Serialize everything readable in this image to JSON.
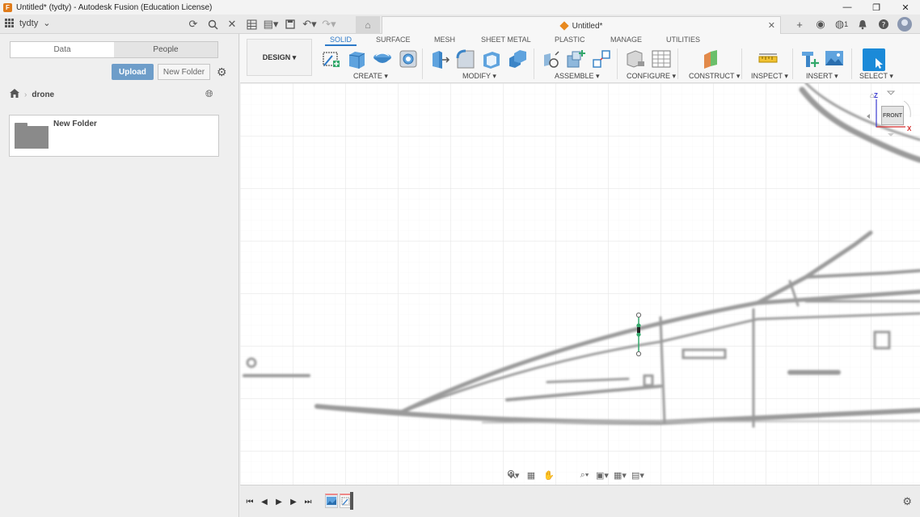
{
  "window": {
    "title": "Untitled* (tydty) - Autodesk Fusion (Education License)",
    "controls": [
      "—",
      "❐",
      "✕"
    ]
  },
  "appbar": {
    "team_name": "tydty",
    "document_tab": "Untitled*",
    "job_count": "1"
  },
  "datapanel": {
    "tabs": [
      "Data",
      "People"
    ],
    "upload_label": "Upload",
    "new_folder_label": "New Folder",
    "breadcrumb": "drone",
    "folders": [
      {
        "name": "New Folder"
      }
    ]
  },
  "toolbar": {
    "workspace_label": "DESIGN ▾",
    "tabs": [
      "SOLID",
      "SURFACE",
      "MESH",
      "SHEET METAL",
      "PLASTIC",
      "MANAGE",
      "UTILITIES"
    ],
    "active_tab": "SOLID",
    "groups": [
      "CREATE ▾",
      "MODIFY ▾",
      "ASSEMBLE ▾",
      "CONFIGURE ▾",
      "CONSTRUCT ▾",
      "INSPECT ▾",
      "INSERT ▾",
      "SELECT ▾"
    ]
  },
  "viewcube": {
    "face": "FRONT",
    "axis_z": "Z",
    "axis_x": "X"
  },
  "colors": {
    "accent": "#2c79c8",
    "upload": "#6e9dc9",
    "brand_orange": "#e07b1a",
    "sketch_green": "#33a86b"
  },
  "icons": {
    "app": "fusion-logo-icon",
    "refresh": "refresh-icon",
    "search": "search-icon",
    "close": "close-icon",
    "apps_grid": "apps-grid-icon",
    "file": "file-icon",
    "save": "save-icon",
    "undo": "undo-icon",
    "redo": "redo-icon",
    "home": "home-icon",
    "add_tab": "plus-icon",
    "online": "online-status-icon",
    "notifications": "bell-icon",
    "help": "help-icon",
    "settings": "gear-icon",
    "globe": "globe-icon"
  }
}
